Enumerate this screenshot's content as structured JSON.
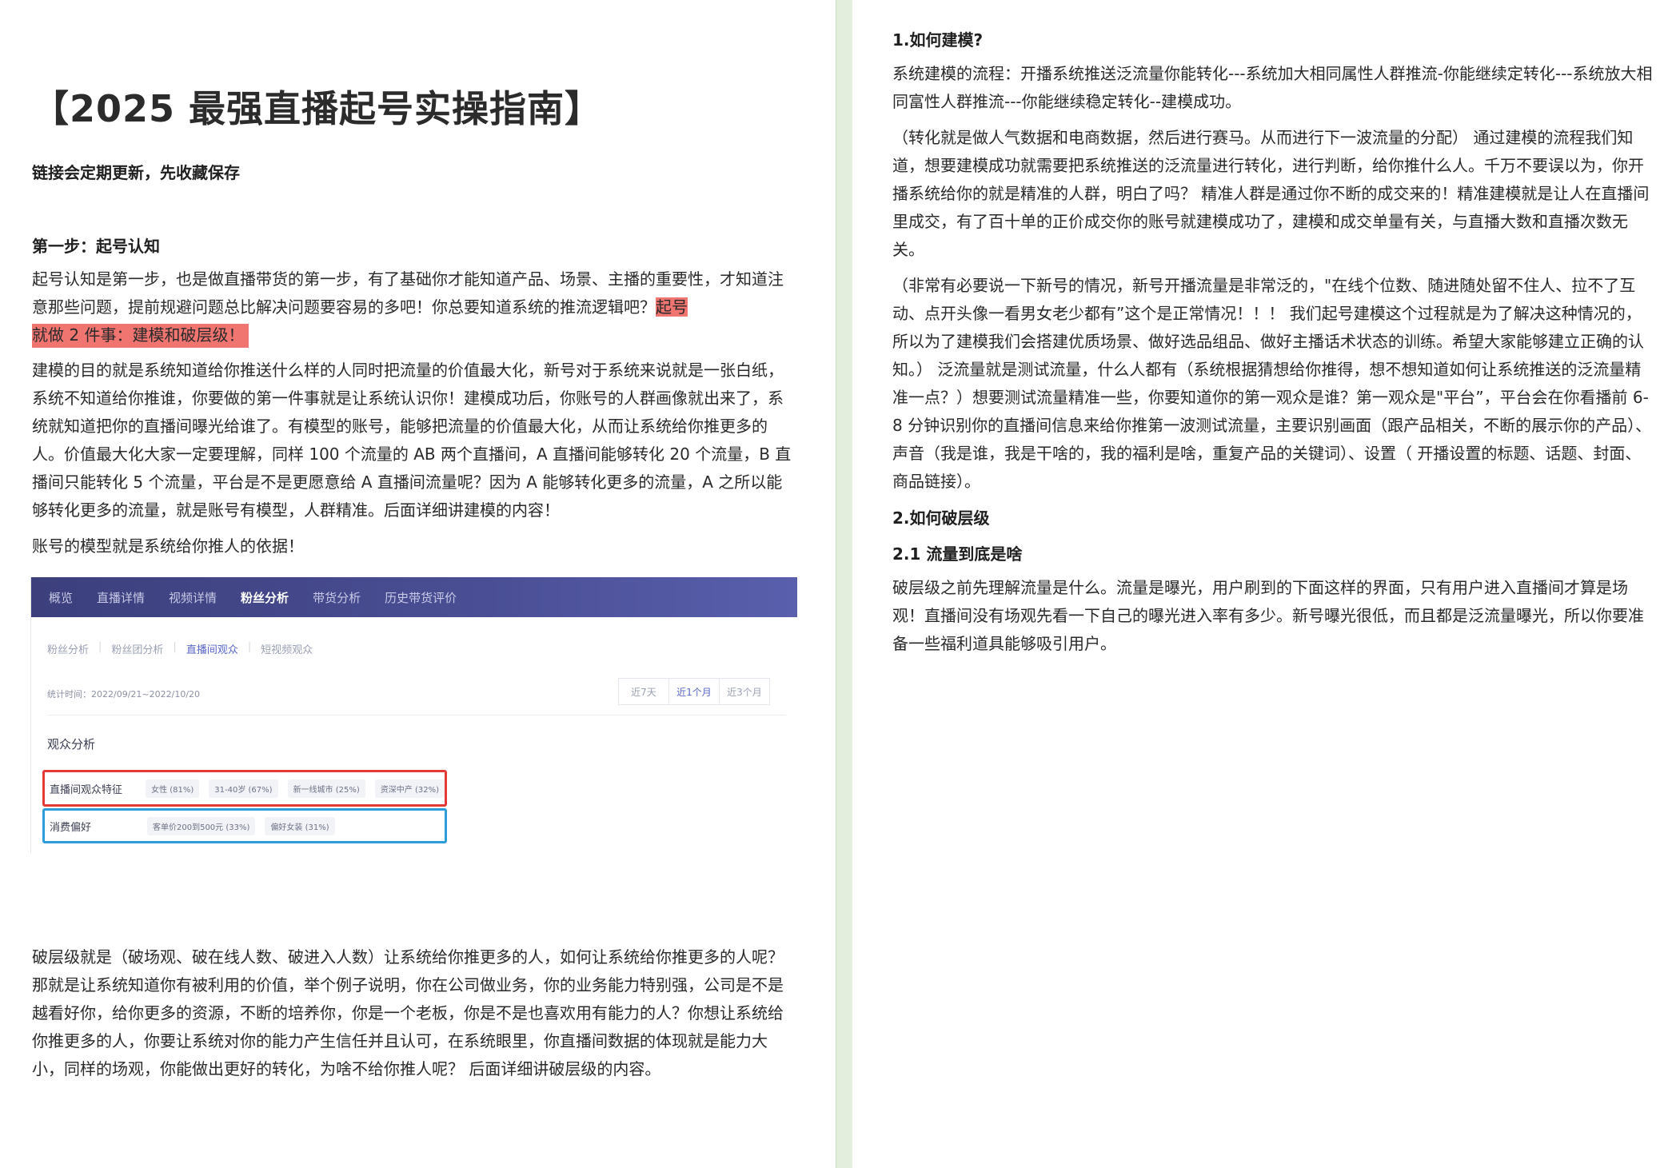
{
  "left": {
    "title": "【2025 最强直播起号实操指南】",
    "subtitle": "链接会定期更新，先收藏保存",
    "step1_heading": "第一步：起号认知",
    "p1_before": "起号认知是第一步，也是做直播带货的第一步，有了基础你才能知道产品、场景、主播的重要性，才知道注意那些问题，提前规避问题总比解决问题要容易的多吧！你总要知道系统的推流逻辑吧？",
    "p1_highlight_a": "起号",
    "p1_highlight_b": "就做 2 件事：建模和破层级！",
    "p2": "建模的目的就是系统知道给你推送什么样的人同时把流量的价值最大化，新号对于系统来说就是一张白纸，系统不知道给你推谁，你要做的第一件事就是让系统认识你！建模成功后，你账号的人群画像就出来了，系统就知道把你的直播间曝光给谁了。有模型的账号，能够把流量的价值最大化，从而让系统给你推更多的人。价值最大化大家一定要理解，同样 100 个流量的 AB 两个直播间，A 直播间能够转化 20 个流量，B 直播间只能转化 5 个流量，平台是不是更愿意给 A 直播间流量呢？因为 A 能够转化更多的流量，A 之所以能够转化更多的流量，就是账号有模型，人群精准。后面详细讲建模的内容！",
    "p3": "账号的模型就是系统给你推人的依据！",
    "p4": "破层级就是（破场观、破在线人数、破进入人数）让系统给你推更多的人，如何让系统给你推更多的人呢？那就是让系统知道你有被利用的价值，举个例子说明，你在公司做业务，你的业务能力特别强，公司是不是越看好你，给你更多的资源，不断的培养你，你是一个老板，你是不是也喜欢用有能力的人？你想让系统给你推更多的人，你要让系统对你的能力产生信任并且认可，在系统眼里，你直播间数据的体现就是能力大小，同样的场观，你能做出更好的转化，为啥不给你推人呢？ 后面详细讲破层级的内容。",
    "screenshot": {
      "nav": [
        "概览",
        "直播详情",
        "视频详情",
        "粉丝分析",
        "带货分析",
        "历史带货评价"
      ],
      "nav_active": "粉丝分析",
      "subtabs": [
        "粉丝分析",
        "粉丝团分析",
        "直播间观众",
        "短视频观众"
      ],
      "subtab_active": "直播间观众",
      "date": "统计时间：2022/09/21~2022/10/20",
      "ranges": [
        "近7天",
        "近1个月",
        "近3个月"
      ],
      "range_active": "近1个月",
      "section": "观众分析",
      "row1_label": "直播间观众特征",
      "row1_chips": [
        "女性 (81%)",
        "31-40岁 (67%)",
        "新一线城市 (25%)",
        "资深中产 (32%)"
      ],
      "row2_label": "消费偏好",
      "row2_chips": [
        "客单价200到500元 (33%)",
        "偏好女装 (31%)"
      ],
      "red_box_color": "#e53935",
      "blue_box_color": "#2d9cdb"
    }
  },
  "right": {
    "h1": "1.如何建模?",
    "r1": "系统建模的流程：开播系统推送泛流量你能转化---系统加大相同属性人群推流-你能继续定转化---系统放大相同富性人群推流---你能继续稳定转化--建模成功。",
    "r2": "（转化就是做人气数据和电商数据，然后进行赛马。从而进行下一波流量的分配） 通过建模的流程我们知道，想要建模成功就需要把系统推送的泛流量进行转化，进行判断，给你推什么人。千万不要误以为，你开播系统给你的就是精准的人群，明白了吗？ 精准人群是通过你不断的成交来的！精准建模就是让人在直播间里成交，有了百十单的正价成交你的账号就建模成功了，建模和成交单量有关，与直播大数和直播次数无关。",
    "r3": "（非常有必要说一下新号的情况，新号开播流量是非常泛的，\"在线个位数、随进随处留不住人、拉不了互动、点开头像一看男女老少都有”这个是正常情况！！！ 我们起号建模这个过程就是为了解决这种情况的，所以为了建模我们会搭建优质场景、做好选品组品、做好主播话术状态的训练。希望大家能够建立正确的认知。） 泛流量就是测试流量，什么人都有（系统根据猜想给你推得，想不想知道如何让系统推送的泛流量精准一点？）想要测试流量精准一些，你要知道你的第一观众是谁？第一观众是\"平台”，平台会在你看播前 6-8 分钟识别你的直播间信息来给你推第一波测试流量，主要识别画面（跟产品相关，不断的展示你的产品）、声音（我是谁，我是干啥的，我的福利是啥，重复产品的关键词）、设置（ 开播设置的标题、话题、封面、商品链接）。",
    "h2": "2.如何破层级",
    "h3": "2.1 流量到底是啥",
    "r4": "破层级之前先理解流量是什么。流量是曝光，用户刷到的下面这样的界面，只有用户进入直播间才算是场观！直播间没有场观先看一下自己的曝光进入率有多少。新号曝光很低，而且都是泛流量曝光，所以你要准备一些福利道具能够吸引用户。"
  },
  "highlight_color": "#f07470"
}
